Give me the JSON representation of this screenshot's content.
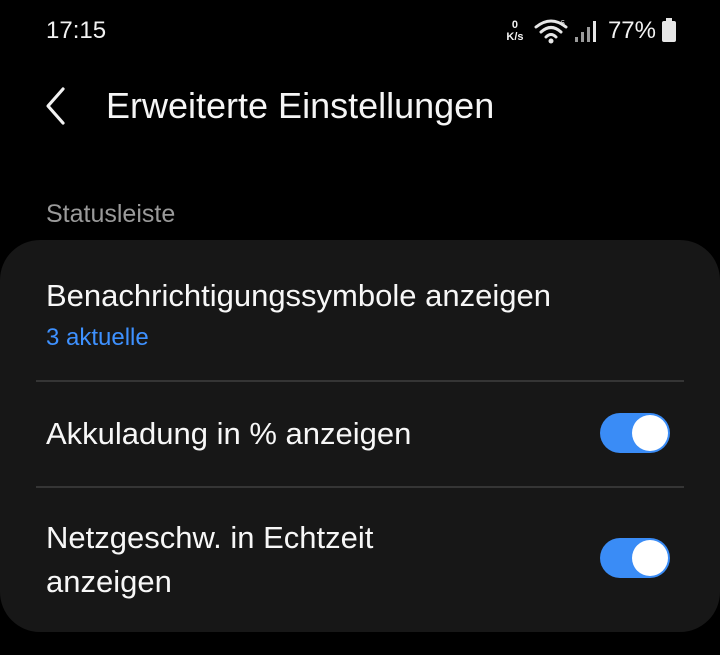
{
  "status_bar": {
    "time": "17:15",
    "net_speed_value": "0",
    "net_speed_unit": "K/s",
    "battery_percent": "77%",
    "icons": [
      "net-speed-icon",
      "wifi-icon",
      "signal-icon",
      "battery-icon"
    ]
  },
  "header": {
    "title": "Erweiterte Einstellungen",
    "back_icon": "chevron-left-icon"
  },
  "section": {
    "label": "Statusleiste"
  },
  "settings": [
    {
      "title": "Benachrichtigungssymbole anzeigen",
      "subtitle": "3 aktuelle"
    },
    {
      "title": "Akkuladung in % anzeigen",
      "toggle_on": true
    },
    {
      "title_line1": "Netzgeschw. in Echtzeit",
      "title_line2": "anzeigen",
      "toggle_on": true
    }
  ],
  "colors": {
    "background": "#000000",
    "card": "#171717",
    "accent": "#3a8cf6",
    "subtitle": "#3e91ff",
    "section_label": "#9a9a9a"
  }
}
